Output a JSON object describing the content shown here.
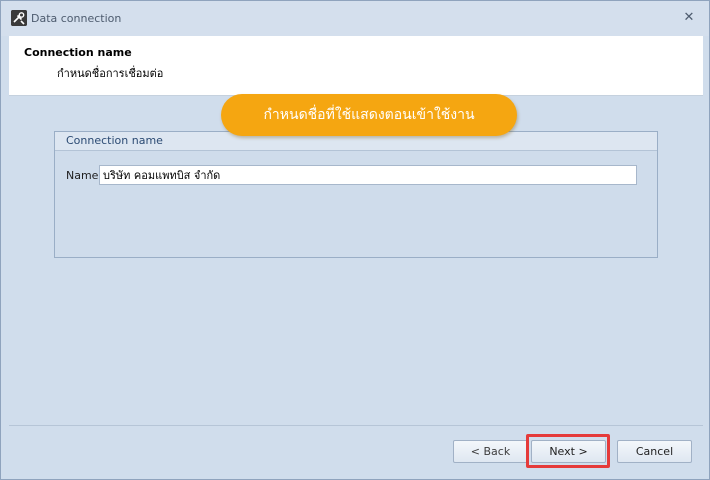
{
  "window": {
    "title": "Data connection",
    "close_label": "✕"
  },
  "header": {
    "title": "Connection name",
    "subtitle": "กำหนดชื่อการเชื่อมต่อ"
  },
  "group": {
    "title": "Connection name",
    "name_label": "Name",
    "name_value": "บริษัท คอมแพทบิส จำกัด"
  },
  "callout": {
    "text": "กำหนดชื่อที่ใช้แสดงตอนเข้าใช้งาน",
    "color": "#f5a611"
  },
  "buttons": {
    "back": "< Back",
    "next": "Next >",
    "cancel": "Cancel"
  },
  "colors": {
    "background": "#d0ddec",
    "highlight": "#e53a3a"
  },
  "icons": {
    "app": "tools-icon",
    "close": "close-icon"
  }
}
